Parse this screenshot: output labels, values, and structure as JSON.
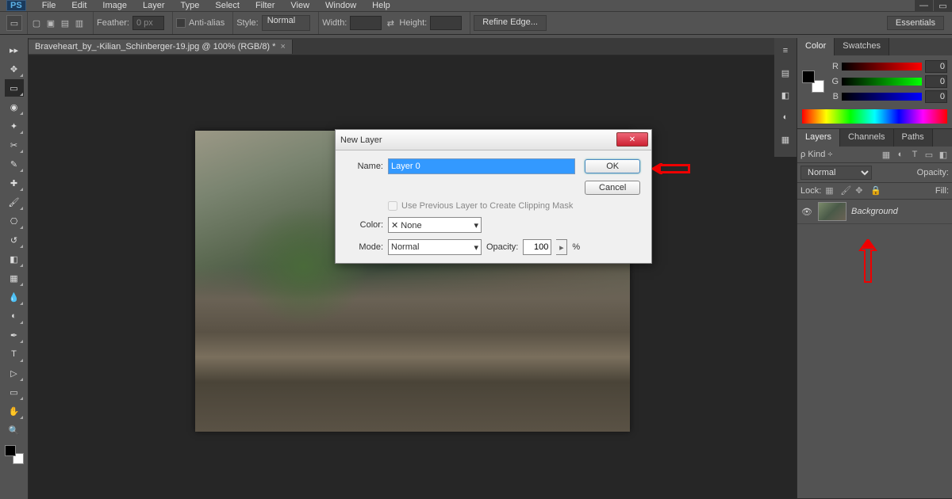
{
  "menu": {
    "items": [
      "File",
      "Edit",
      "Image",
      "Layer",
      "Type",
      "Select",
      "Filter",
      "View",
      "Window",
      "Help"
    ]
  },
  "options": {
    "feather_label": "Feather:",
    "feather_value": "0 px",
    "antialias_label": "Anti-alias",
    "style_label": "Style:",
    "style_value": "Normal",
    "width_label": "Width:",
    "height_label": "Height:",
    "refine_label": "Refine Edge..."
  },
  "essentials_label": "Essentials",
  "doc_tab": "Braveheart_by_-Kilian_Schinberger-19.jpg @ 100% (RGB/8) *",
  "panels": {
    "color_tab": "Color",
    "swatches_tab": "Swatches",
    "rgb": {
      "r_label": "R",
      "g_label": "G",
      "b_label": "B",
      "r": "0",
      "g": "0",
      "b": "0"
    },
    "layers_tab": "Layers",
    "channels_tab": "Channels",
    "paths_tab": "Paths",
    "kind_label": "Kind",
    "blend_mode": "Normal",
    "opacity_label": "Opacity:",
    "lock_label": "Lock:",
    "fill_label": "Fill:",
    "background_layer": "Background"
  },
  "dialog": {
    "title": "New Layer",
    "name_label": "Name:",
    "name_value": "Layer 0",
    "clip_label": "Use Previous Layer to Create Clipping Mask",
    "color_label": "Color:",
    "color_value": "None",
    "mode_label": "Mode:",
    "mode_value": "Normal",
    "opacity_label": "Opacity:",
    "opacity_value": "100",
    "percent": "%",
    "ok": "OK",
    "cancel": "Cancel"
  }
}
